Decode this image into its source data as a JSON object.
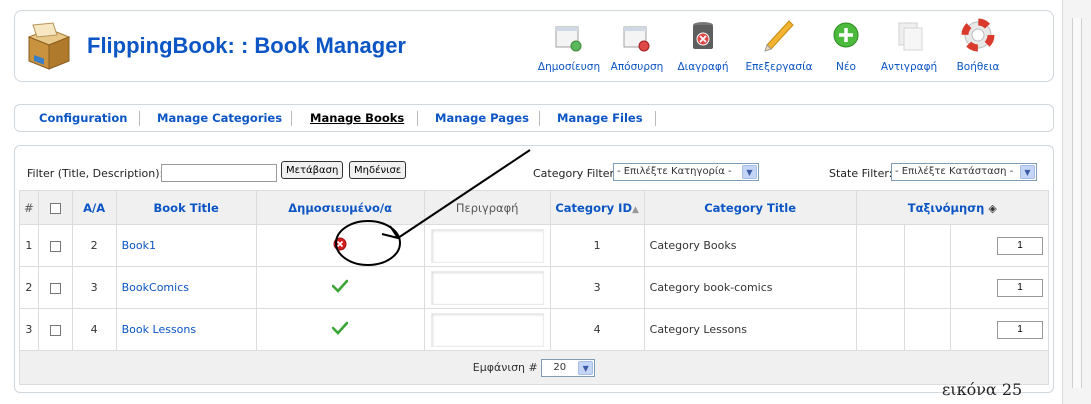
{
  "header": {
    "title": "FlippingBook: : Book Manager",
    "toolbar": [
      {
        "label": "Δημοσίευση",
        "icon": "publish-icon"
      },
      {
        "label": "Απόσυρση",
        "icon": "unpublish-icon"
      },
      {
        "label": "Διαγραφή",
        "icon": "trash-icon"
      },
      {
        "label": "Επεξεργασία",
        "icon": "edit-pencil-icon"
      },
      {
        "label": "Νέο",
        "icon": "new-plus-icon"
      },
      {
        "label": "Αντιγραφή",
        "icon": "copy-icon"
      },
      {
        "label": "Βοήθεια",
        "icon": "help-lifebuoy-icon"
      }
    ]
  },
  "submenu": {
    "tabs": [
      "Configuration",
      "Manage Categories",
      "Manage Books",
      "Manage Pages",
      "Manage Files"
    ],
    "active": "Manage Books"
  },
  "filters": {
    "filter_label": "Filter (Title, Description):",
    "filter_value": "",
    "go_button": "Μετάβαση",
    "reset_button": "Μηδένισε",
    "category_label": "Category Filter:",
    "category_value": "- Επιλέξτε Κατηγορία -",
    "state_label": "State Filter:",
    "state_value": "- Επιλέξτε Κατάσταση -"
  },
  "table": {
    "headers": {
      "num": "#",
      "aa": "A/A",
      "title": "Book Title",
      "published": "Δημοσιευμένο/α",
      "description": "Περιγραφή",
      "category_id": "Category ID",
      "category_title": "Category Title",
      "ordering": "Ταξινόμηση"
    },
    "rows": [
      {
        "num": "1",
        "aa": "2",
        "title": "Book1",
        "published": false,
        "category_id": "1",
        "category_title": "Category Books",
        "order": "1"
      },
      {
        "num": "2",
        "aa": "3",
        "title": "BookComics",
        "published": true,
        "category_id": "3",
        "category_title": "Category book-comics",
        "order": "1"
      },
      {
        "num": "3",
        "aa": "4",
        "title": "Book Lessons",
        "published": true,
        "category_id": "4",
        "category_title": "Category Lessons",
        "order": "1"
      }
    ],
    "footer_label": "Εμφάνιση #",
    "footer_value": "20"
  },
  "caption": "εικόνα 25",
  "colors": {
    "link": "#0b55c4",
    "published": "#3aa535",
    "unpublished": "#d42020"
  }
}
